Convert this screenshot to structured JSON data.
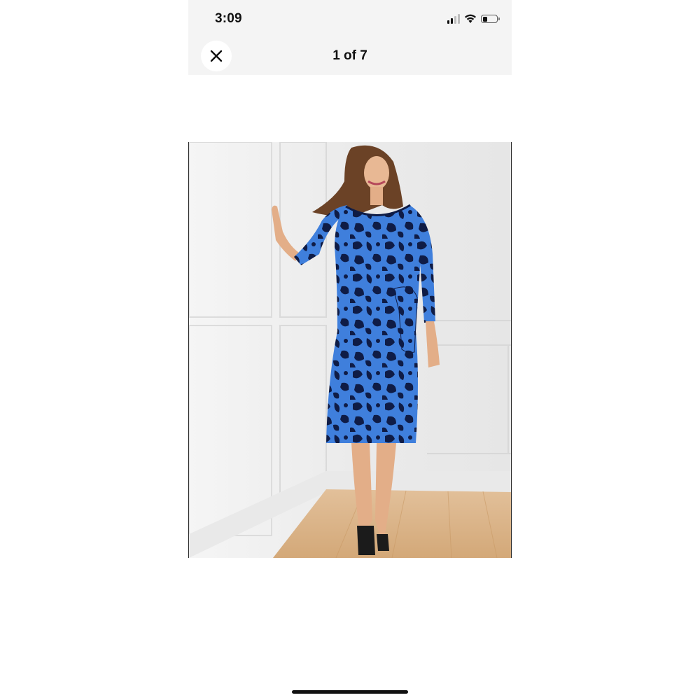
{
  "status_bar": {
    "time": "3:09",
    "icons": [
      "cellular-signal-icon",
      "wifi-icon",
      "battery-icon"
    ],
    "signal_bars": 2,
    "signal_bars_total": 4,
    "battery_level": 0.3
  },
  "viewer": {
    "close_icon": "close-icon",
    "page_indicator": "1 of 7"
  },
  "colors": {
    "header_background": "#f4f4f4",
    "dress_blue": "#3f7fdc",
    "dress_navy": "#0f1c46",
    "floor": "#d9b48a",
    "wall": "#eeeeee"
  }
}
